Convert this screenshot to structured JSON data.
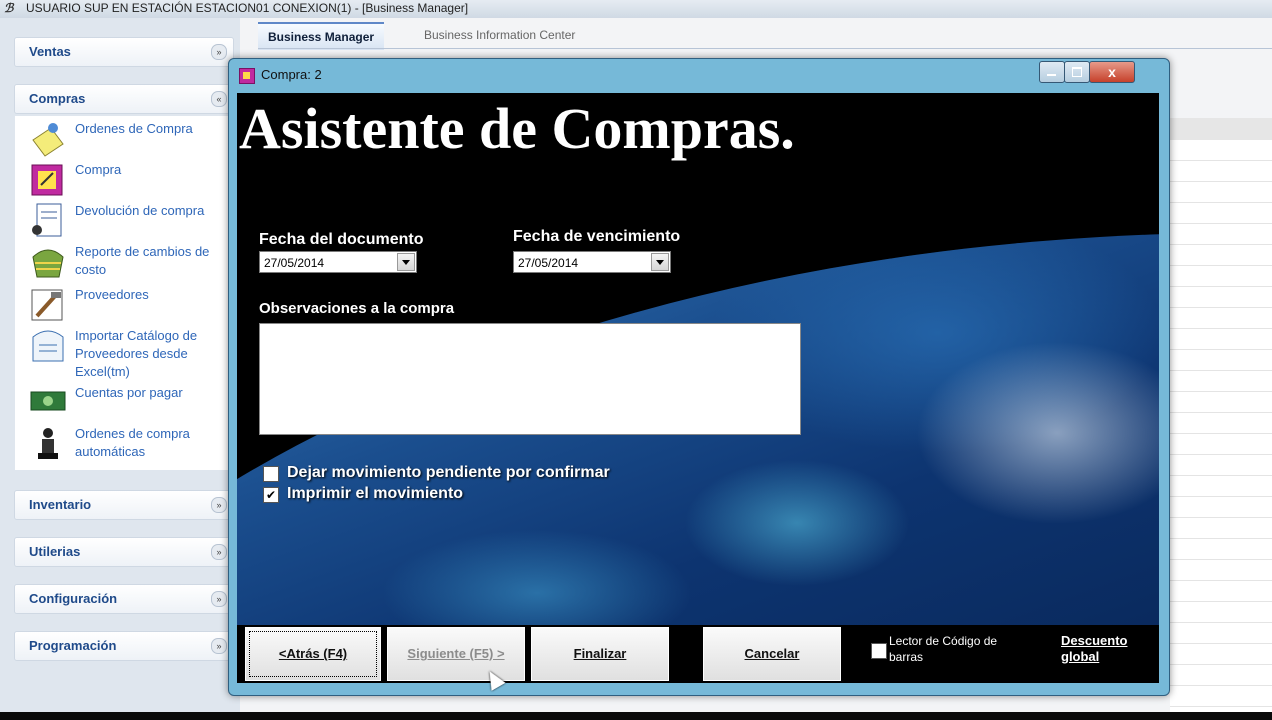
{
  "app": {
    "title": "USUARIO SUP EN ESTACIÓN ESTACION01    CONEXION(1) - [Business Manager]"
  },
  "tabs": [
    {
      "label": "Business Manager",
      "active": true
    },
    {
      "label": "Business Information Center",
      "active": false
    }
  ],
  "sidebar": {
    "sections": [
      {
        "label": "Ventas"
      },
      {
        "label": "Compras"
      },
      {
        "label": "Inventario"
      },
      {
        "label": "Utilerias"
      },
      {
        "label": "Configuración"
      },
      {
        "label": "Programación"
      }
    ],
    "compras_items": [
      {
        "label": "Ordenes de Compra",
        "icon": "purchase-order-icon"
      },
      {
        "label": "Compra",
        "icon": "purchase-icon"
      },
      {
        "label": "Devolución de compra",
        "icon": "purchase-return-icon"
      },
      {
        "label": "Reporte de cambios de costo",
        "icon": "cost-report-icon"
      },
      {
        "label": "Proveedores",
        "icon": "suppliers-icon"
      },
      {
        "label": "Importar Catálogo de Proveedores desde Excel(tm)",
        "icon": "import-catalog-icon"
      },
      {
        "label": "Cuentas por pagar",
        "icon": "accounts-payable-icon"
      },
      {
        "label": "Ordenes de compra automáticas",
        "icon": "auto-orders-icon"
      }
    ]
  },
  "dialog": {
    "title": "Compra: 2",
    "close_label": "x",
    "heading": "Asistente de Compras.",
    "fecha_documento": {
      "label": "Fecha del documento",
      "value": "27/05/2014"
    },
    "fecha_vencimiento": {
      "label": "Fecha de vencimiento",
      "value": "27/05/2014"
    },
    "observaciones": {
      "label": "Observaciones a la compra",
      "value": ""
    },
    "checkboxes": [
      {
        "label": "Dejar movimiento pendiente por confirmar",
        "checked": false
      },
      {
        "label": "Imprimir el movimiento",
        "checked": true
      }
    ],
    "buttons": {
      "atras": "<Atrás (F4)",
      "siguiente": "Siguiente (F5) >",
      "finalizar": "Finalizar",
      "cancelar": "Cancelar"
    },
    "lector": {
      "label": "Lector de Código de barras",
      "checked": false
    },
    "descuento": "Descuento global"
  }
}
